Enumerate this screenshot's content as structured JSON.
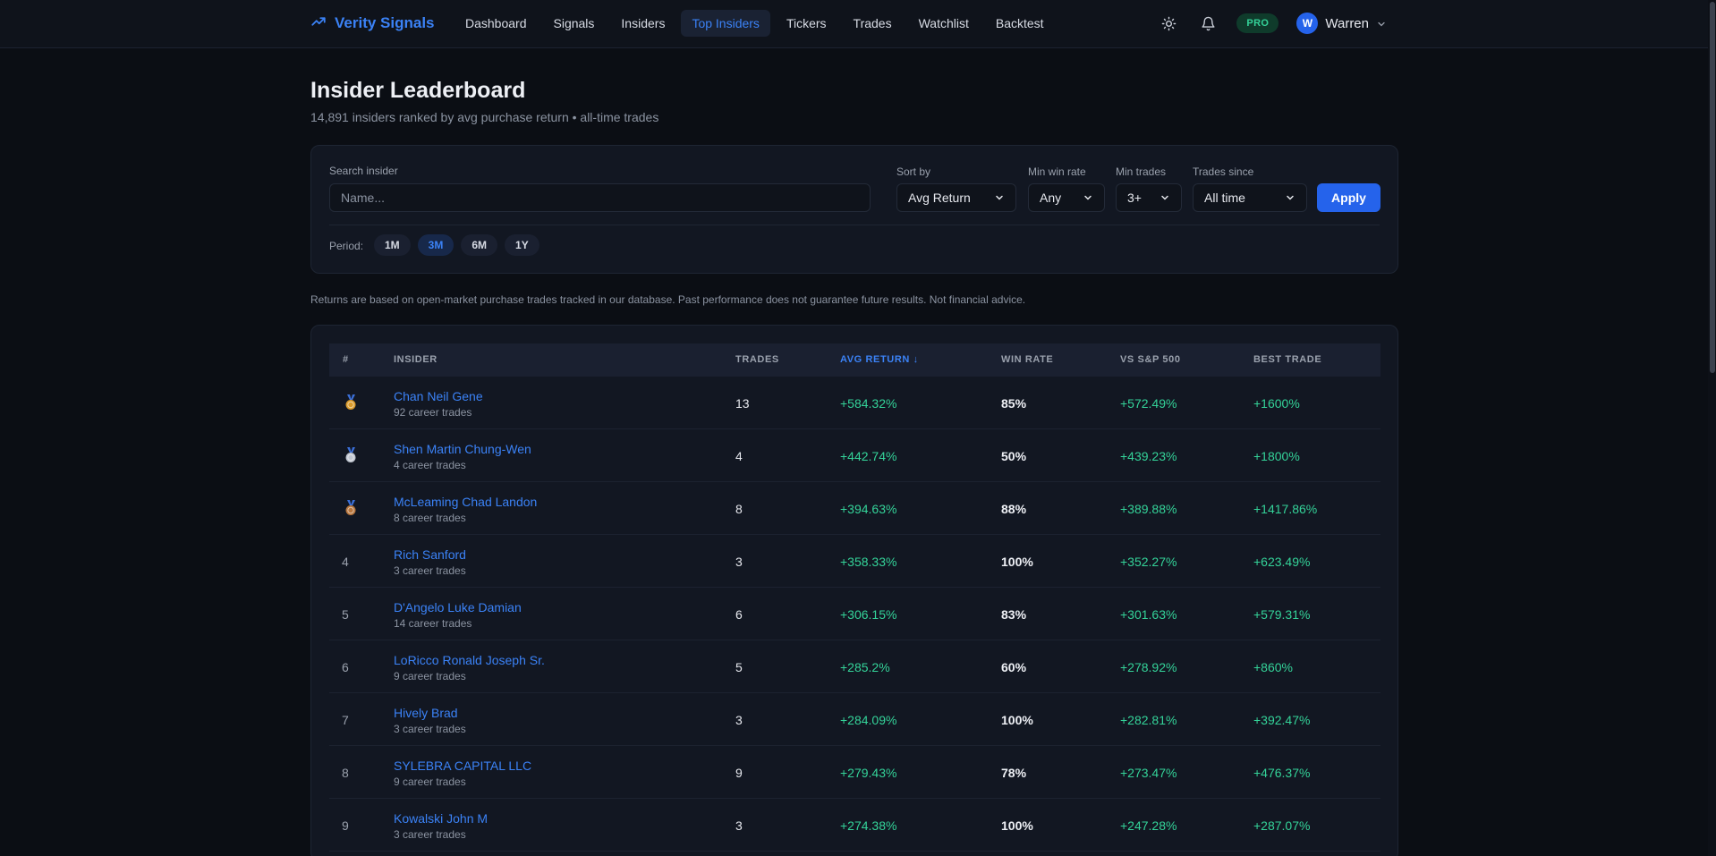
{
  "brand": {
    "name": "Verity Signals"
  },
  "nav": [
    {
      "label": "Dashboard",
      "active": false
    },
    {
      "label": "Signals",
      "active": false
    },
    {
      "label": "Insiders",
      "active": false
    },
    {
      "label": "Top Insiders",
      "active": true
    },
    {
      "label": "Tickers",
      "active": false
    },
    {
      "label": "Trades",
      "active": false
    },
    {
      "label": "Watchlist",
      "active": false
    },
    {
      "label": "Backtest",
      "active": false
    }
  ],
  "topbar": {
    "pro_badge": "PRO",
    "user_initial": "W",
    "user_name": "Warren"
  },
  "page": {
    "title": "Insider Leaderboard",
    "subtitle": "14,891 insiders ranked by avg purchase return • all-time trades",
    "disclaimer": "Returns are based on open-market purchase trades tracked in our database. Past performance does not guarantee future results. Not financial advice."
  },
  "filters": {
    "search_label": "Search insider",
    "search_placeholder": "Name...",
    "sort_label": "Sort by",
    "sort_value": "Avg Return",
    "min_win_label": "Min win rate",
    "min_win_value": "Any",
    "min_trades_label": "Min trades",
    "min_trades_value": "3+",
    "since_label": "Trades since",
    "since_value": "All time",
    "apply_label": "Apply",
    "period_label": "Period:",
    "periods": [
      {
        "label": "1M",
        "active": false
      },
      {
        "label": "3M",
        "active": true
      },
      {
        "label": "6M",
        "active": false
      },
      {
        "label": "1Y",
        "active": false
      }
    ]
  },
  "table": {
    "headers": {
      "rank": "#",
      "insider": "INSIDER",
      "trades": "TRADES",
      "avg_return": "AVG RETURN ↓",
      "win_rate": "WIN RATE",
      "vs_sp": "VS S&P 500",
      "best": "BEST TRADE"
    },
    "rows": [
      {
        "rank": "1",
        "medal": "gold",
        "name": "Chan Neil Gene",
        "career": "92 career trades",
        "trades": "13",
        "avg_return": "+584.32%",
        "win_rate": "85%",
        "vs_sp": "+572.49%",
        "best": "+1600%"
      },
      {
        "rank": "2",
        "medal": "silver",
        "name": "Shen Martin Chung-Wen",
        "career": "4 career trades",
        "trades": "4",
        "avg_return": "+442.74%",
        "win_rate": "50%",
        "vs_sp": "+439.23%",
        "best": "+1800%"
      },
      {
        "rank": "3",
        "medal": "bronze",
        "name": "McLeaming Chad Landon",
        "career": "8 career trades",
        "trades": "8",
        "avg_return": "+394.63%",
        "win_rate": "88%",
        "vs_sp": "+389.88%",
        "best": "+1417.86%"
      },
      {
        "rank": "4",
        "medal": "",
        "name": "Rich Sanford",
        "career": "3 career trades",
        "trades": "3",
        "avg_return": "+358.33%",
        "win_rate": "100%",
        "vs_sp": "+352.27%",
        "best": "+623.49%"
      },
      {
        "rank": "5",
        "medal": "",
        "name": "D'Angelo Luke Damian",
        "career": "14 career trades",
        "trades": "6",
        "avg_return": "+306.15%",
        "win_rate": "83%",
        "vs_sp": "+301.63%",
        "best": "+579.31%"
      },
      {
        "rank": "6",
        "medal": "",
        "name": "LoRicco Ronald Joseph Sr.",
        "career": "9 career trades",
        "trades": "5",
        "avg_return": "+285.2%",
        "win_rate": "60%",
        "vs_sp": "+278.92%",
        "best": "+860%"
      },
      {
        "rank": "7",
        "medal": "",
        "name": "Hively Brad",
        "career": "3 career trades",
        "trades": "3",
        "avg_return": "+284.09%",
        "win_rate": "100%",
        "vs_sp": "+282.81%",
        "best": "+392.47%"
      },
      {
        "rank": "8",
        "medal": "",
        "name": "SYLEBRA CAPITAL LLC",
        "career": "9 career trades",
        "trades": "9",
        "avg_return": "+279.43%",
        "win_rate": "78%",
        "vs_sp": "+273.47%",
        "best": "+476.37%"
      },
      {
        "rank": "9",
        "medal": "",
        "name": "Kowalski John M",
        "career": "3 career trades",
        "trades": "3",
        "avg_return": "+274.38%",
        "win_rate": "100%",
        "vs_sp": "+247.28%",
        "best": "+287.07%"
      }
    ]
  },
  "colors": {
    "accent": "#3b82f6",
    "positive": "#34d399",
    "gold": "#d99a2b",
    "silver": "#c0c6d0",
    "bronze": "#b8763d"
  }
}
